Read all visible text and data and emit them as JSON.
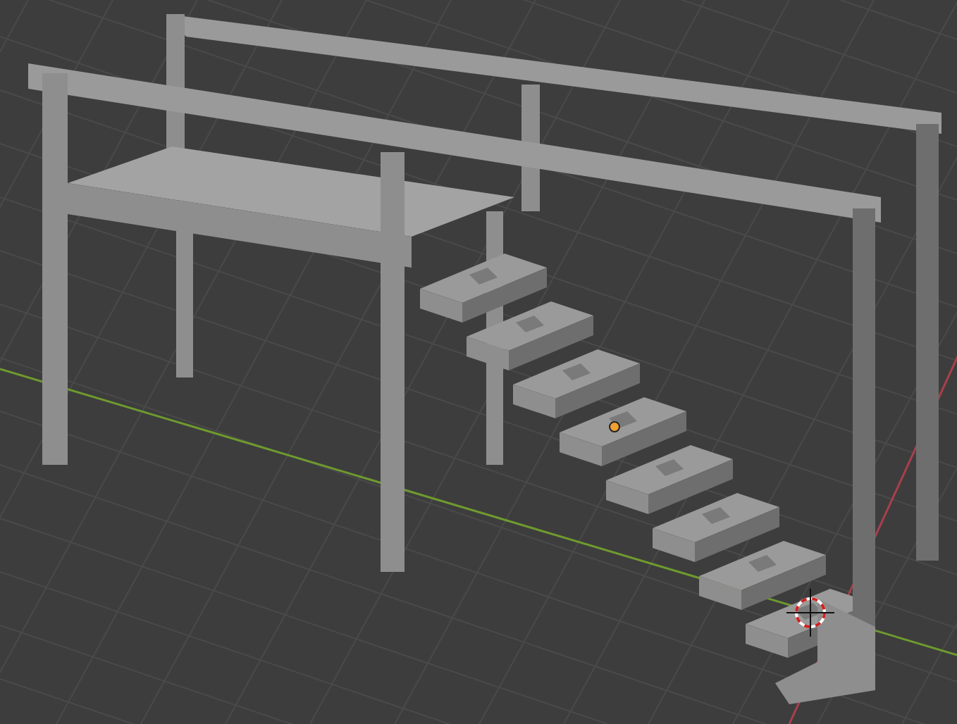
{
  "viewport": {
    "grid": true,
    "axes": true,
    "origin_dot": true,
    "cursor": true
  }
}
